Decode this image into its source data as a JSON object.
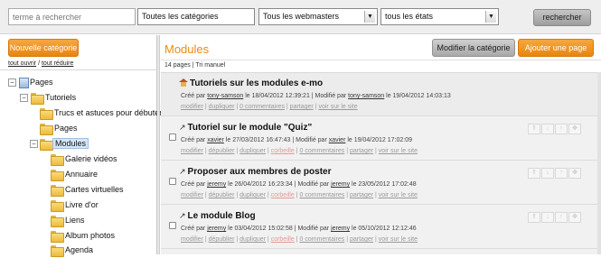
{
  "search": {
    "placeholder": "terme à rechercher",
    "categories_label": "Toutes les catégories",
    "webmasters_label": "Tous les webmasters",
    "states_label": "tous les états",
    "submit_label": "rechercher"
  },
  "sidebar": {
    "new_category_label": "Nouvelle catégorie",
    "open_all": "tout ouvrir",
    "separator": "/",
    "collapse_all": "tout réduire",
    "tree": [
      {
        "label": "Pages",
        "toggle": "−",
        "icon": "pages-icon"
      },
      {
        "label": "Tutoriels",
        "toggle": "−",
        "icon": "folder-icon"
      },
      {
        "label": "Trucs et astuces pour débuter",
        "toggle": "",
        "icon": "folder-icon"
      },
      {
        "label": "Pages",
        "toggle": "",
        "icon": "folder-icon"
      },
      {
        "label": "Modules",
        "toggle": "−",
        "icon": "folder-icon",
        "selected": true
      },
      {
        "label": "Galerie vidéos",
        "toggle": "",
        "icon": "folder-icon"
      },
      {
        "label": "Annuaire",
        "toggle": "",
        "icon": "folder-icon"
      },
      {
        "label": "Cartes virtuelles",
        "toggle": "",
        "icon": "folder-icon"
      },
      {
        "label": "Livre d'or",
        "toggle": "",
        "icon": "folder-icon"
      },
      {
        "label": "Liens",
        "toggle": "",
        "icon": "folder-icon"
      },
      {
        "label": "Album photos",
        "toggle": "",
        "icon": "folder-icon"
      },
      {
        "label": "Agenda",
        "toggle": "",
        "icon": "folder-icon"
      }
    ]
  },
  "main": {
    "title": "Modules",
    "edit_category_label": "Modifier la catégorie",
    "add_page_label": "Ajouter une page",
    "count_text": "14 pages | Tri manuel",
    "rows": [
      {
        "title": "Tutoriels sur les modules e-mo",
        "icon": "home-icon",
        "created_prefix": "Créé par ",
        "created_by": "tony-samson",
        "created_on": " le 18/04/2012 12:39:21 | Modifié par ",
        "modified_by": "tony-samson",
        "modified_on": " le 19/04/2012 14:03:13",
        "actions": [
          "modifier",
          "dupliquer",
          "0 commentaires",
          "partager",
          "voir sur le site"
        ],
        "has_checkbox": false
      },
      {
        "title": "Tutoriel sur le module \"Quiz\"",
        "icon": "link-icon",
        "created_prefix": "Créé par ",
        "created_by": "xavier",
        "created_on": " le 27/03/2012 16:47:43 | Modifié par ",
        "modified_by": "xavier",
        "modified_on": " le 19/04/2012 17:02:09",
        "actions": [
          "modifier",
          "dépublier",
          "dupliquer",
          "corbeille",
          "0 commentaires",
          "partager",
          "voir sur le site"
        ],
        "has_checkbox": true
      },
      {
        "title": "Proposer aux membres de poster",
        "icon": "link-icon",
        "created_prefix": "Créé par ",
        "created_by": "jeremy",
        "created_on": " le 26/04/2012 16:23:34 | Modifié par ",
        "modified_by": "jeremy",
        "modified_on": " le 23/05/2012 17:02:48",
        "actions": [
          "modifier",
          "dépublier",
          "dupliquer",
          "corbeille",
          "0 commentaires",
          "partager",
          "voir sur le site"
        ],
        "has_checkbox": true
      },
      {
        "title": "Le module Blog",
        "icon": "link-icon",
        "created_prefix": "Créé par ",
        "created_by": "jeremy",
        "created_on": " le 03/04/2012 15:02:58 | Modifié par ",
        "modified_by": "jeremy",
        "modified_on": " le 05/10/2012 12:12:46",
        "actions": [
          "modifier",
          "dépublier",
          "dupliquer",
          "corbeille",
          "0 commentaires",
          "partager",
          "voir sur le site"
        ],
        "has_checkbox": true
      }
    ]
  },
  "colors": {
    "accent": "#ee8a13",
    "button_orange": "#e8850f",
    "selection": "#d7e6f7"
  }
}
